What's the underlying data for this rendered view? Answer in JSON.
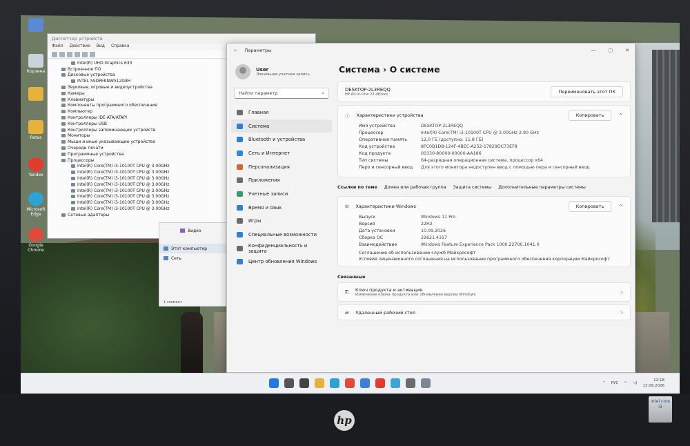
{
  "desktop": {
    "icons": [
      {
        "label": "Корзина"
      },
      {
        "label": "Retas"
      },
      {
        "label": "Yandex"
      },
      {
        "label": "Microsoft Edge"
      },
      {
        "label": "Google Chrome"
      }
    ]
  },
  "device_manager": {
    "title": "Диспетчер устройств",
    "menu": [
      "Файл",
      "Действие",
      "Вид",
      "Справка"
    ],
    "tree": [
      {
        "level": 2,
        "label": "Intel(R) UHD Graphics 630"
      },
      {
        "level": 1,
        "label": "Встроенное ПО"
      },
      {
        "level": 1,
        "label": "Дисковые устройства"
      },
      {
        "level": 2,
        "label": "INTEL SSDPEKNW512G8H"
      },
      {
        "level": 1,
        "label": "Звуковые, игровые и видеоустройства"
      },
      {
        "level": 1,
        "label": "Камеры"
      },
      {
        "level": 1,
        "label": "Клавиатуры"
      },
      {
        "level": 1,
        "label": "Компоненты программного обеспечения"
      },
      {
        "level": 1,
        "label": "Компьютер"
      },
      {
        "level": 1,
        "label": "Контроллеры IDE ATA/ATAPI"
      },
      {
        "level": 1,
        "label": "Контроллеры USB"
      },
      {
        "level": 1,
        "label": "Контроллеры запоминающих устройств"
      },
      {
        "level": 1,
        "label": "Мониторы"
      },
      {
        "level": 1,
        "label": "Мыши и иные указывающие устройства"
      },
      {
        "level": 1,
        "label": "Очереди печати"
      },
      {
        "level": 1,
        "label": "Программные устройства"
      },
      {
        "level": 1,
        "label": "Процессоры"
      },
      {
        "level": 2,
        "label": "Intel(R) Core(TM) i3-10100T CPU @ 3.00GHz"
      },
      {
        "level": 2,
        "label": "Intel(R) Core(TM) i3-10100T CPU @ 3.00GHz"
      },
      {
        "level": 2,
        "label": "Intel(R) Core(TM) i3-10100T CPU @ 3.00GHz"
      },
      {
        "level": 2,
        "label": "Intel(R) Core(TM) i3-10100T CPU @ 3.00GHz"
      },
      {
        "level": 2,
        "label": "Intel(R) Core(TM) i3-10100T CPU @ 3.00GHz"
      },
      {
        "level": 2,
        "label": "Intel(R) Core(TM) i3-10100T CPU @ 3.00GHz"
      },
      {
        "level": 2,
        "label": "Intel(R) Core(TM) i3-10100T CPU @ 3.00GHz"
      },
      {
        "level": 2,
        "label": "Intel(R) Core(TM) i3-10100T CPU @ 3.00GHz"
      },
      {
        "level": 1,
        "label": "Сетевые адаптеры"
      }
    ]
  },
  "explorer": {
    "items": [
      "Видео",
      "Этот компьютер",
      "Сеть"
    ],
    "status": "1 элемент"
  },
  "settings": {
    "window_title": "Параметры",
    "user": {
      "name": "User",
      "sub": "Локальная учетная запись"
    },
    "search_placeholder": "Найти параметр",
    "nav": [
      {
        "label": "Главная",
        "color": "#6b6b6b"
      },
      {
        "label": "Система",
        "color": "#2f7fd8"
      },
      {
        "label": "Bluetooth и устройства",
        "color": "#2f7fd8"
      },
      {
        "label": "Сеть и Интернет",
        "color": "#2a88e0"
      },
      {
        "label": "Персонализация",
        "color": "#d0672e"
      },
      {
        "label": "Приложения",
        "color": "#6b6b6b"
      },
      {
        "label": "Учетные записи",
        "color": "#2ea06b"
      },
      {
        "label": "Время и язык",
        "color": "#2f7fd8"
      },
      {
        "label": "Игры",
        "color": "#6b6b6b"
      },
      {
        "label": "Специальные возможности",
        "color": "#2f7fd8"
      },
      {
        "label": "Конфиденциальность и защита",
        "color": "#6b6b6b"
      },
      {
        "label": "Центр обновления Windows",
        "color": "#2f7fd8"
      }
    ],
    "breadcrumb": "Система  ›  О системе",
    "device": {
      "name": "DESKTOP-2L3REQQ",
      "model": "HP All-in-One 22-df0xxx",
      "rename": "Переименовать этот ПК"
    },
    "device_specs": {
      "header": "Характеристики устройства",
      "copy": "Копировать",
      "rows": [
        [
          "Имя устройства",
          "DESKTOP-2L3REQQ"
        ],
        [
          "Процессор",
          "Intel(R) Core(TM) i3-10100T CPU @ 3.00GHz   2.90 GHz"
        ],
        [
          "Оперативная память",
          "12,0 ГБ (доступно: 11,8 ГБ)"
        ],
        [
          "Код устройства",
          "8FC0B1D8-124F-4BEC-A252-17829DC73EF8"
        ],
        [
          "Код продукта",
          "00330-80000-00000-AA186"
        ],
        [
          "Тип системы",
          "64-разрядная операционная система, процессор x64"
        ],
        [
          "Перо и сенсорный ввод",
          "Для этого монитора недоступен ввод с помощью пера и сенсорный ввод"
        ]
      ]
    },
    "links": [
      "Ссылки по теме",
      "Домен или рабочая группа",
      "Защита системы",
      "Дополнительные параметры системы"
    ],
    "windows_specs": {
      "header": "Характеристики Windows",
      "copy": "Копировать",
      "rows": [
        [
          "Выпуск",
          "Windows 11 Pro"
        ],
        [
          "Версия",
          "22H2"
        ],
        [
          "Дата установки",
          "10.09.2026"
        ],
        [
          "Сборка ОС",
          "22621.4317"
        ],
        [
          "Взаимодействие",
          "Windows Feature Experience Pack 1000.22700.1041.0"
        ]
      ],
      "terms": [
        "Соглашение об использовании служб Майкрософт",
        "Условия лицензионного соглашения на использование программного обеспечения корпорации Майкрософт"
      ]
    },
    "related": {
      "header": "Связанные",
      "items": [
        {
          "title": "Ключ продукта и активация",
          "sub": "Изменение ключа продукта или обновление версии Windows"
        },
        {
          "title": "Удаленный рабочий стол",
          "sub": ""
        }
      ]
    }
  },
  "taskbar": {
    "icons": [
      {
        "name": "start-icon",
        "color": "#1f7ae0"
      },
      {
        "name": "search-icon",
        "color": "#555555"
      },
      {
        "name": "taskview-icon",
        "color": "#444444"
      },
      {
        "name": "explorer-icon",
        "color": "#e8b23a"
      },
      {
        "name": "edge-icon",
        "color": "#2aa3d6"
      },
      {
        "name": "chrome-icon",
        "color": "#e04a3a"
      },
      {
        "name": "store-icon",
        "color": "#3b82d6"
      },
      {
        "name": "yandex-icon",
        "color": "#e33b2e"
      },
      {
        "name": "photos-icon",
        "color": "#3ba6d9"
      },
      {
        "name": "settings-icon",
        "color": "#6b6b6b"
      },
      {
        "name": "devmgr-icon",
        "color": "#7a8896"
      }
    ],
    "lang": "РУС",
    "time": "12:18",
    "date": "13.09.2026"
  },
  "monitor": {
    "brand": "hp",
    "sticker": "intel core i3"
  }
}
